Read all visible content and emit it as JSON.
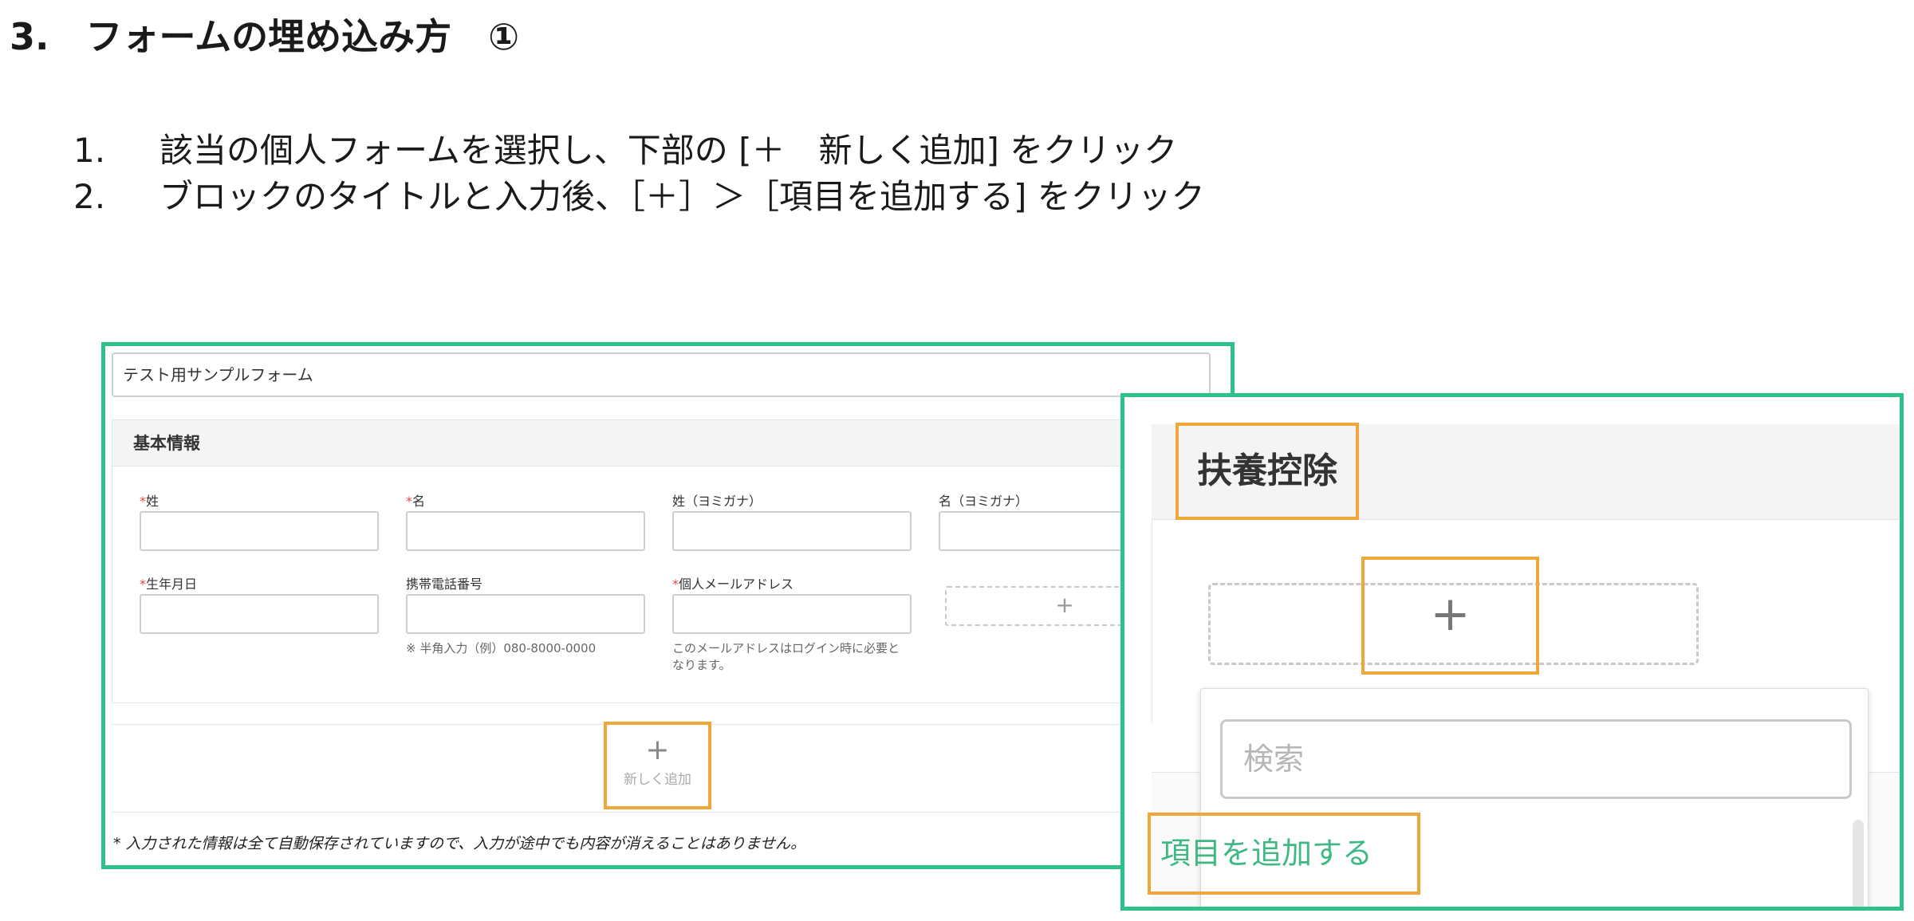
{
  "slide": {
    "title": "3.　フォームの埋め込み方　①",
    "steps": [
      {
        "num": "1.",
        "text": "該当の個人フォームを選択し、下部の [＋　新しく追加] をクリック"
      },
      {
        "num": "2.",
        "text": "ブロックのタイトルと入力後、［＋］＞［項目を追加する] をクリック"
      }
    ]
  },
  "form": {
    "name": "テスト用サンプルフォーム",
    "block_title": "基本情報",
    "fields": [
      {
        "label": "姓",
        "required": "*"
      },
      {
        "label": "名",
        "required": "*"
      },
      {
        "label": "姓（ヨミガナ）",
        "required": ""
      },
      {
        "label": "名（ヨミガナ）",
        "required": ""
      },
      {
        "label": "生年月日",
        "required": "*"
      },
      {
        "label": "携帯電話番号",
        "required": "",
        "hint": "※ 半角入力（例）080-8000-0000"
      },
      {
        "label": "個人メールアドレス",
        "required": "*",
        "hint": "このメールアドレスはログイン時に必要と\nなります。"
      }
    ],
    "add_field_plus": "+",
    "new_add_plus": "+",
    "new_add_label": "新しく追加",
    "autosave_note": "* 入力された情報は全て自動保存されていますので、入力が途中でも内容が消えることはありません。"
  },
  "zoom": {
    "block_title": "扶養控除",
    "plus": "+",
    "search_placeholder": "検索",
    "add_item_label": "項目を追加する"
  },
  "colors": {
    "highlight_green": "#2ec28a",
    "highlight_orange": "#f0a73a",
    "required_red": "#e24a4a",
    "link_green": "#3fb984"
  }
}
